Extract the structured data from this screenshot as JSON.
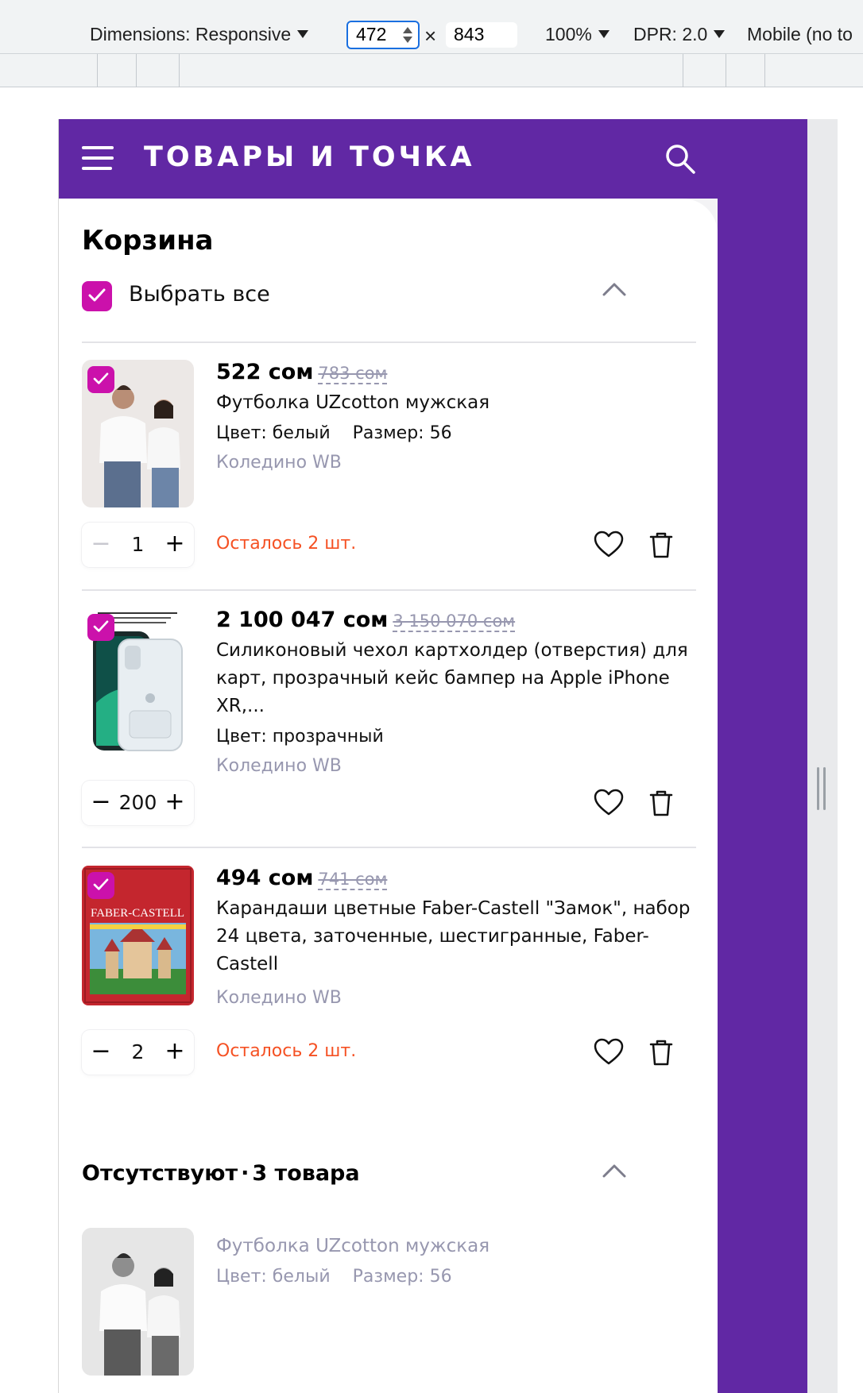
{
  "devtools": {
    "dimensions_label": "Dimensions: Responsive",
    "width_value": "472",
    "times": "×",
    "height_value": "843",
    "zoom": "100%",
    "dpr": "DPR: 2.0",
    "throttle": "Mobile (no to"
  },
  "header": {
    "brand": "ТОВАРЫ И ТОЧКА",
    "menu_icon": "hamburger-icon",
    "search_icon": "search-icon",
    "brand_color": "#6128a4"
  },
  "cart": {
    "title": "Корзина",
    "select_all": "Выбрать все",
    "checkbox_color": "#cb11ab",
    "items": [
      {
        "price": "522 сом",
        "old_price": "783 сом",
        "name": "Футболка UZcotton мужская",
        "color": "Цвет: белый",
        "size": "Размер: 56",
        "store": "Коледино WB",
        "qty": "1",
        "left": "Осталось 2 шт.",
        "checked": true
      },
      {
        "price": "2 100 047 сом",
        "old_price": "3 150 070 сом",
        "name": "Силиконовый чехол картхолдер (отверстия) для карт, прозрачный кейс бампер на Apple iPhone XR,...",
        "color": "Цвет: прозрачный",
        "store": "Коледино WB",
        "qty": "200",
        "checked": true
      },
      {
        "price": "494 сом",
        "old_price": "741 сом",
        "name": "Карандаши цветные Faber-Castell \"Замок\", набор 24 цвета, заточенные, шестигранные, Faber-Castell",
        "store": "Коледино WB",
        "qty": "2",
        "left": "Осталось 2 шт.",
        "checked": true,
        "box_brand": "FABER-CASTELL"
      }
    ],
    "minus": "−",
    "plus": "+"
  },
  "missing": {
    "title_a": "Отсутствуют",
    "dot": "·",
    "title_b": "3 товара",
    "items": [
      {
        "name": "Футболка UZcotton мужская",
        "color": "Цвет: белый",
        "size": "Размер: 56"
      }
    ]
  }
}
